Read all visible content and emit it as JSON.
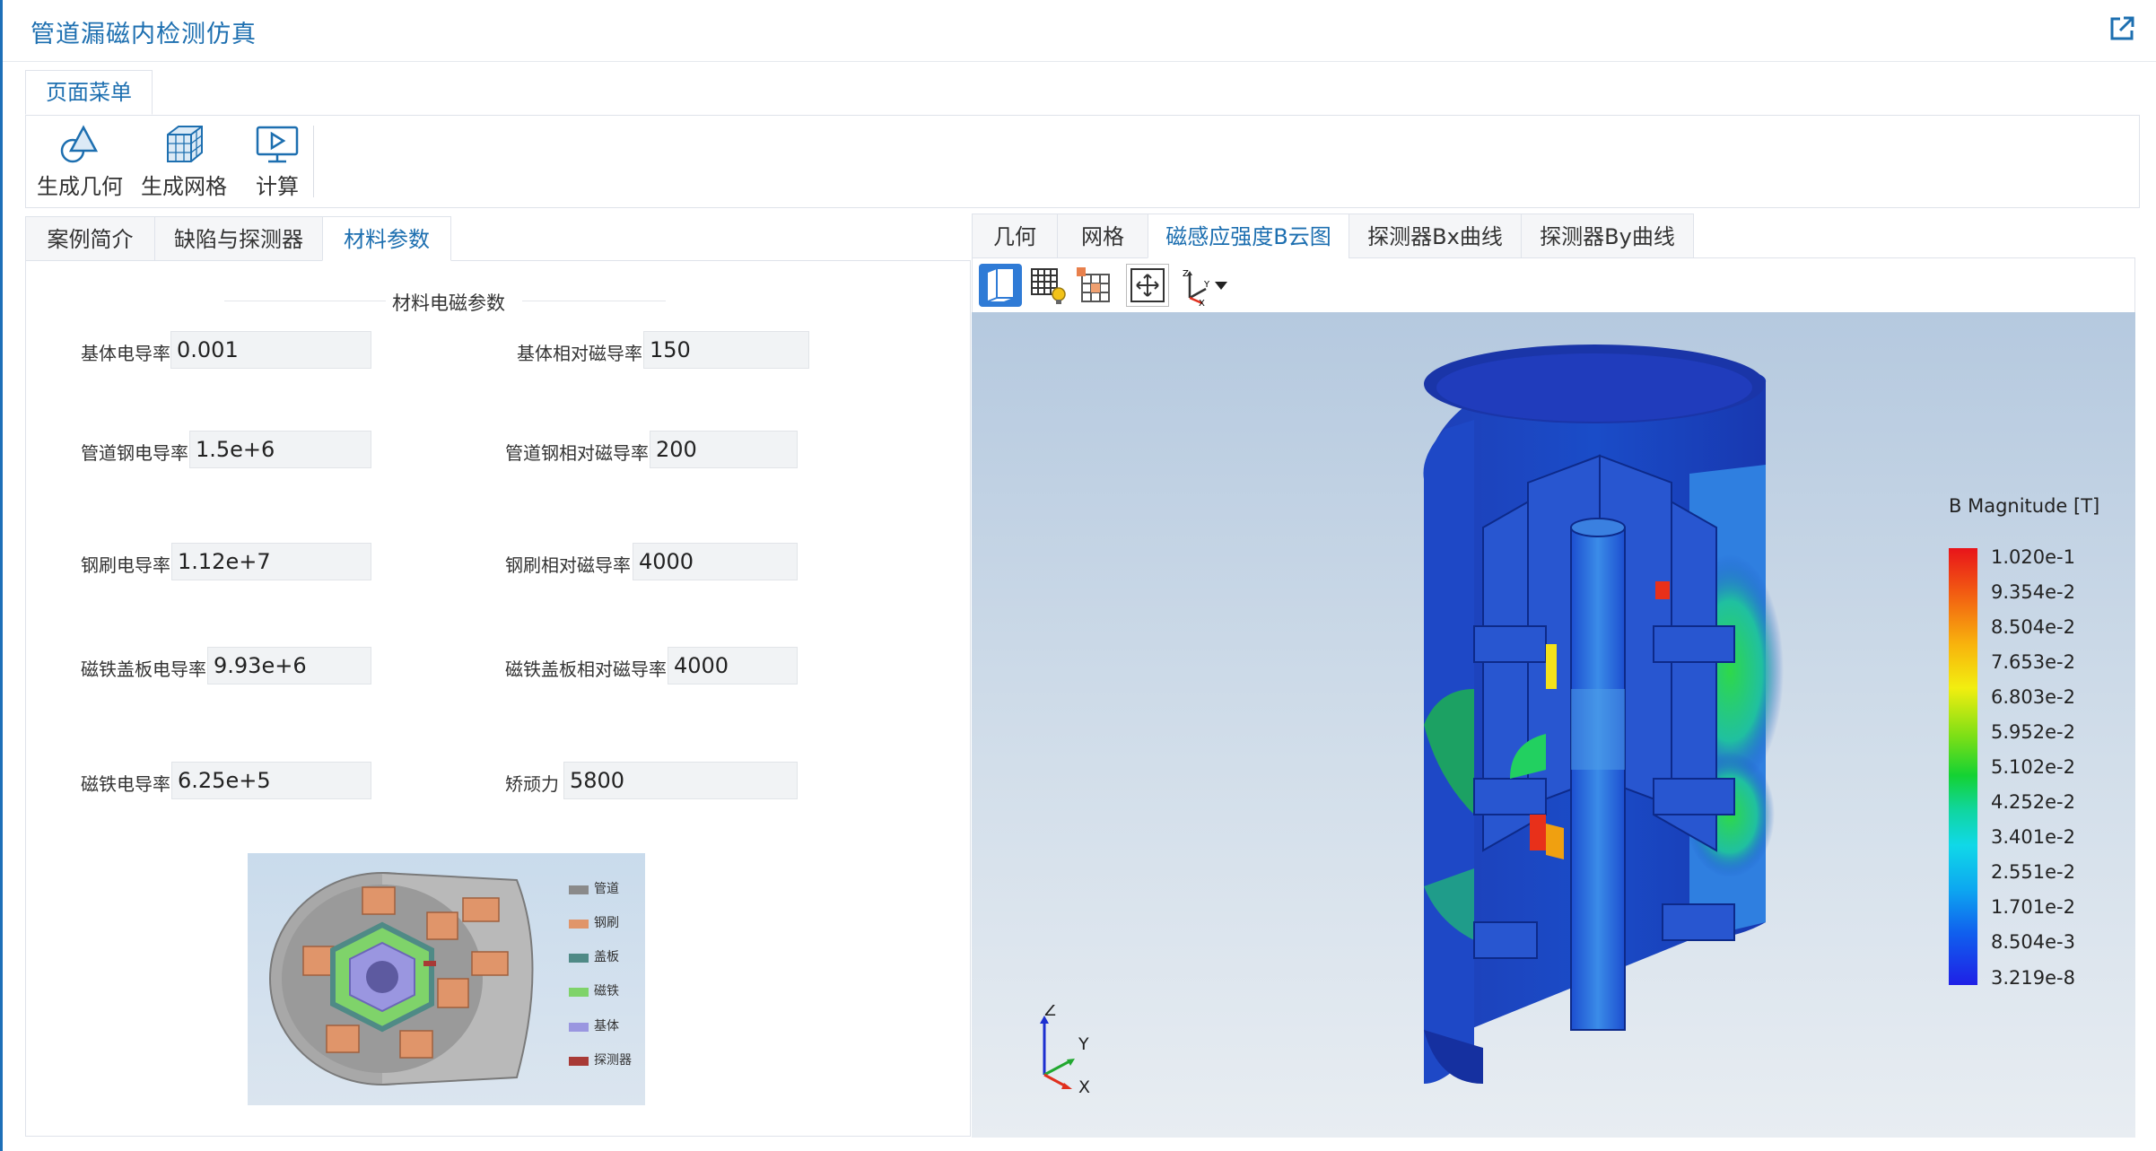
{
  "app": {
    "title": "管道漏磁内检测仿真"
  },
  "menu": {
    "tab_label": "页面菜单"
  },
  "toolbar": {
    "items": [
      {
        "label": "生成几何",
        "icon": "geometry-shapes-icon"
      },
      {
        "label": "生成网格",
        "icon": "mesh-cube-icon"
      },
      {
        "label": "计算",
        "icon": "compute-monitor-icon"
      }
    ]
  },
  "left_tabs": [
    {
      "label": "案例简介",
      "active": false
    },
    {
      "label": "缺陷与探测器",
      "active": false
    },
    {
      "label": "材料参数",
      "active": true
    }
  ],
  "params": {
    "section_title": "材料电磁参数",
    "fields": [
      {
        "label": "基体电导率",
        "value": "0.001"
      },
      {
        "label": "基体相对磁导率",
        "value": "150"
      },
      {
        "label": "管道钢电导率",
        "value": "1.5e+6"
      },
      {
        "label": "管道钢相对磁导率",
        "value": "200"
      },
      {
        "label": "钢刷电导率",
        "value": "1.12e+7"
      },
      {
        "label": "钢刷相对磁导率",
        "value": "4000"
      },
      {
        "label": "磁铁盖板电导率",
        "value": "9.93e+6"
      },
      {
        "label": "磁铁盖板相对磁导率",
        "value": "4000"
      },
      {
        "label": "磁铁电导率",
        "value": "6.25e+5"
      },
      {
        "label": "矫顽力",
        "value": "5800"
      }
    ]
  },
  "legend_image": {
    "items": [
      {
        "label": "管道",
        "color": "#8a8a8a"
      },
      {
        "label": "钢刷",
        "color": "#e0956a"
      },
      {
        "label": "盖板",
        "color": "#4f8a86"
      },
      {
        "label": "磁铁",
        "color": "#7fd36a"
      },
      {
        "label": "基体",
        "color": "#9a96e0"
      },
      {
        "label": "探测器",
        "color": "#a83a36"
      }
    ]
  },
  "right_tabs": [
    {
      "label": "几何",
      "active": false
    },
    {
      "label": "网格",
      "active": false
    },
    {
      "label": "磁感应强度B云图",
      "active": true
    },
    {
      "label": "探测器Bx曲线",
      "active": false
    },
    {
      "label": "探测器By曲线",
      "active": false
    }
  ],
  "viewer": {
    "colorbar_title": "B Magnitude [T]",
    "colorbar_labels": [
      "1.020e-1",
      "9.354e-2",
      "8.504e-2",
      "7.653e-2",
      "6.803e-2",
      "5.952e-2",
      "5.102e-2",
      "4.252e-2",
      "3.401e-2",
      "2.551e-2",
      "1.701e-2",
      "8.504e-3",
      "3.219e-8"
    ],
    "axes": {
      "z": "Z",
      "y": "Y",
      "x": "X"
    }
  },
  "colors": {
    "accent": "#1d6fb0",
    "border": "#dfe3ea"
  }
}
